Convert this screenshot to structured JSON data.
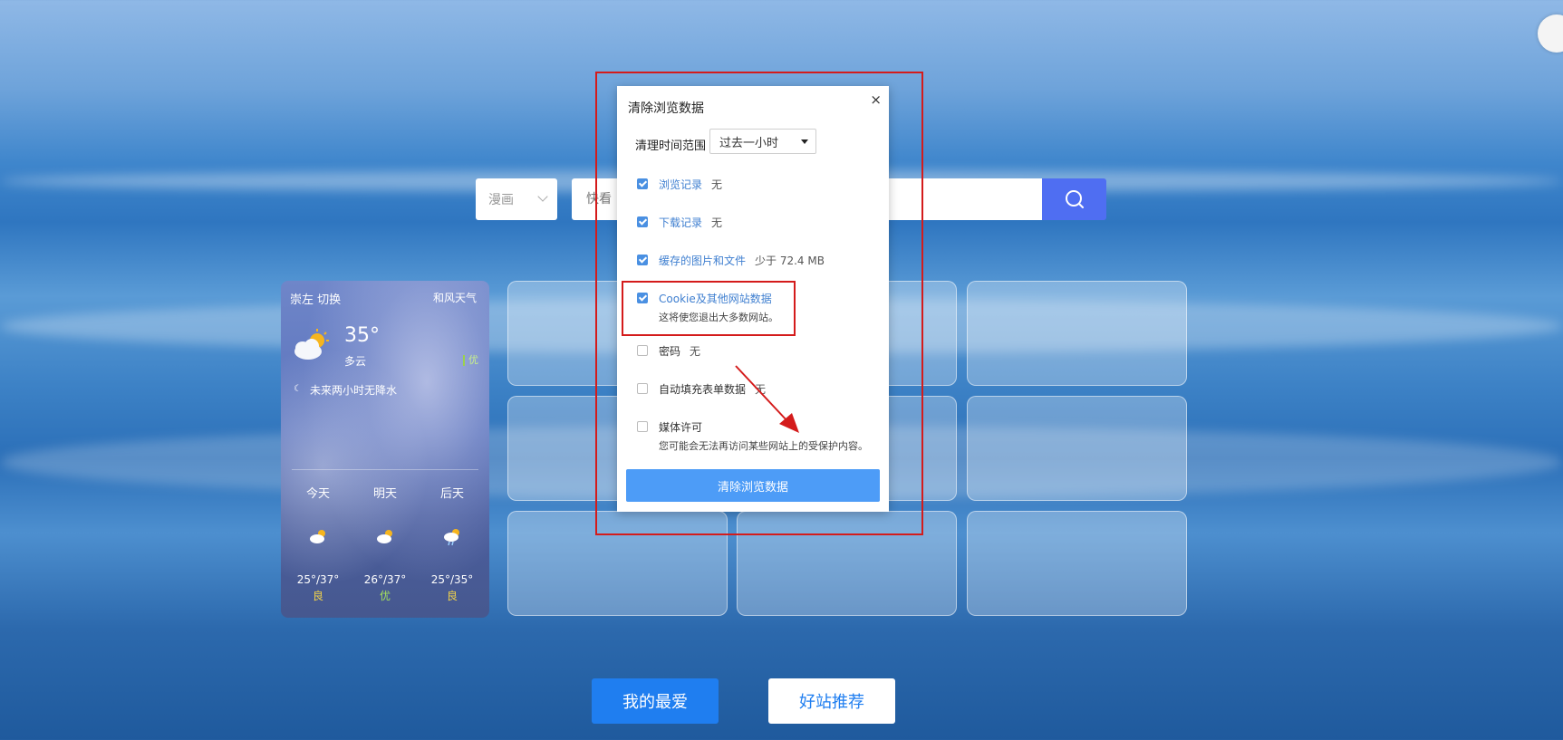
{
  "search": {
    "category": "漫画",
    "placeholder": "快看",
    "icon": "search-icon"
  },
  "weather": {
    "location": "崇左",
    "switch_label": "切换",
    "source": "和风天气",
    "temperature": "35°",
    "condition": "多云",
    "aqi": "优",
    "precip_note": "未来两小时无降水",
    "forecast": [
      {
        "day": "今天",
        "range": "25°/37°",
        "quality": "良",
        "icon": "partly-cloudy-icon"
      },
      {
        "day": "明天",
        "range": "26°/37°",
        "quality": "优",
        "icon": "partly-cloudy-icon"
      },
      {
        "day": "后天",
        "range": "25°/35°",
        "quality": "良",
        "icon": "rain-cloud-icon"
      }
    ]
  },
  "bottom_nav": {
    "favorites": "我的最爱",
    "recommended": "好站推荐"
  },
  "dialog": {
    "title": "清除浏览数据",
    "close": "×",
    "range_label": "清理时间范围",
    "range_value": "过去一小时",
    "items": [
      {
        "label": "浏览记录",
        "value": "无",
        "checked": true
      },
      {
        "label": "下载记录",
        "value": "无",
        "checked": true
      },
      {
        "label": "缓存的图片和文件",
        "value": "少于 72.4 MB",
        "checked": true
      },
      {
        "label": "Cookie及其他网站数据",
        "sub": "这将使您退出大多数网站。",
        "checked": true
      },
      {
        "label": "密码",
        "value": "无",
        "checked": false
      },
      {
        "label": "自动填充表单数据",
        "value": "无",
        "checked": false
      },
      {
        "label": "媒体许可",
        "sub": "您可能会无法再访问某些网站上的受保护内容。",
        "checked": false
      }
    ],
    "clear_button": "清除浏览数据"
  },
  "colors": {
    "accent": "#1f7ef0",
    "search_button": "#4f6ef2",
    "dialog_button": "#4d9cf7",
    "annotation": "#d41b1b"
  }
}
